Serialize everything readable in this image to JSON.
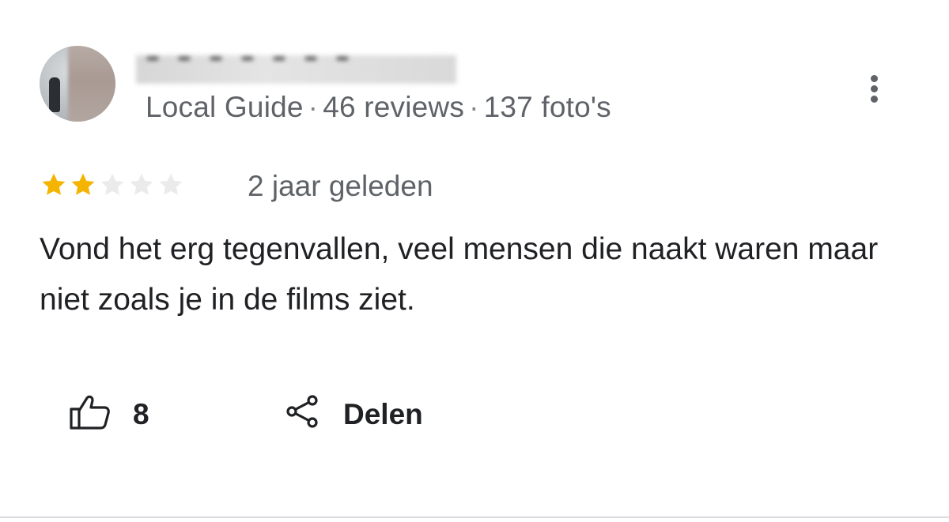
{
  "review": {
    "reviewer": {
      "meta": {
        "role": "Local Guide",
        "separator": "·",
        "reviews": "46 reviews",
        "photos": "137 foto's"
      }
    },
    "rating": {
      "value": 2,
      "max": 5,
      "filled_color": "#f4b400",
      "empty_color": "#ebebeb"
    },
    "time_ago": "2 jaar geleden",
    "text": "Vond het erg tegenvallen, veel mensen die naakt waren maar niet zoals je in de films ziet.",
    "actions": {
      "like_count": "8",
      "share_label": "Delen"
    }
  },
  "icons": {
    "more": "more-vert-icon",
    "like": "thumbs-up-icon",
    "share": "share-icon",
    "star": "star-icon"
  }
}
